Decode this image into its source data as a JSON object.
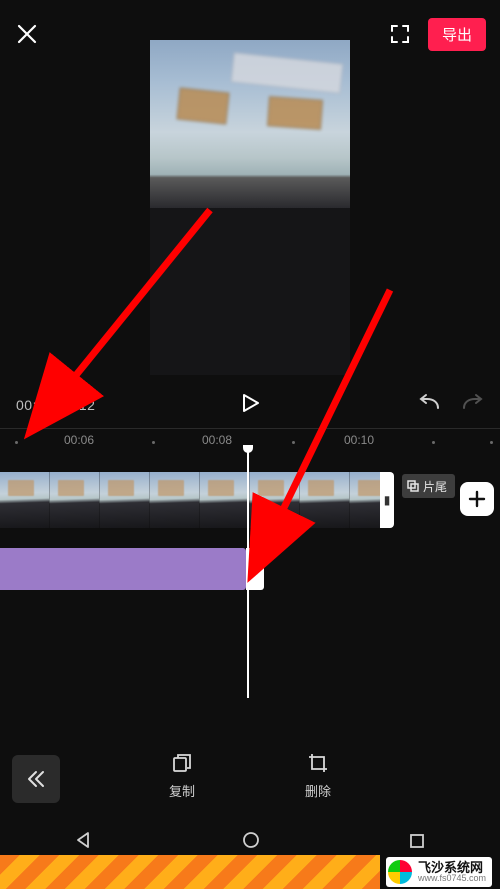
{
  "header": {
    "export_label": "导出"
  },
  "controls": {
    "current_time": "00:08",
    "total_time": "00:12"
  },
  "ruler": {
    "marks": [
      "00:06",
      "00:08",
      "00:10"
    ]
  },
  "timeline": {
    "pianwei_label": "片尾"
  },
  "tools": {
    "copy_label": "复制",
    "delete_label": "删除"
  },
  "watermark": {
    "title": "飞沙系统网",
    "url": "www.fs0745.com"
  },
  "icons": {
    "close": "close-icon",
    "fullscreen": "fullscreen-icon",
    "play": "play-icon",
    "undo": "undo-icon",
    "redo": "redo-icon",
    "add": "plus-icon",
    "collapse": "chevrons-left-icon",
    "copy": "copy-icon",
    "delete": "crop-delete-icon",
    "nav_back": "triangle-left-icon",
    "nav_home": "circle-icon",
    "nav_recent": "square-icon"
  }
}
